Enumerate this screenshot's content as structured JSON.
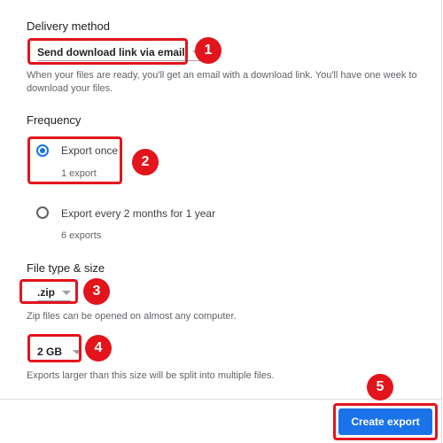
{
  "delivery": {
    "heading": "Delivery method",
    "select_value": "Send download link via email",
    "helper": "When your files are ready, you'll get an email with a download link. You'll have one week to download your files."
  },
  "frequency": {
    "heading": "Frequency",
    "options": [
      {
        "label": "Export once",
        "sub": "1 export",
        "checked": true
      },
      {
        "label": "Export every 2 months for 1 year",
        "sub": "6 exports",
        "checked": false
      }
    ]
  },
  "filetype": {
    "heading": "File type & size",
    "type_value": ".zip",
    "type_helper": "Zip files can be opened on almost any computer.",
    "size_value": "2 GB",
    "size_helper": "Exports larger than this size will be split into multiple files."
  },
  "footer": {
    "create_label": "Create export"
  },
  "annotations": [
    "1",
    "2",
    "3",
    "4",
    "5"
  ],
  "colors": {
    "accent": "#1a73e8",
    "annotation_red": "#e3141b"
  }
}
